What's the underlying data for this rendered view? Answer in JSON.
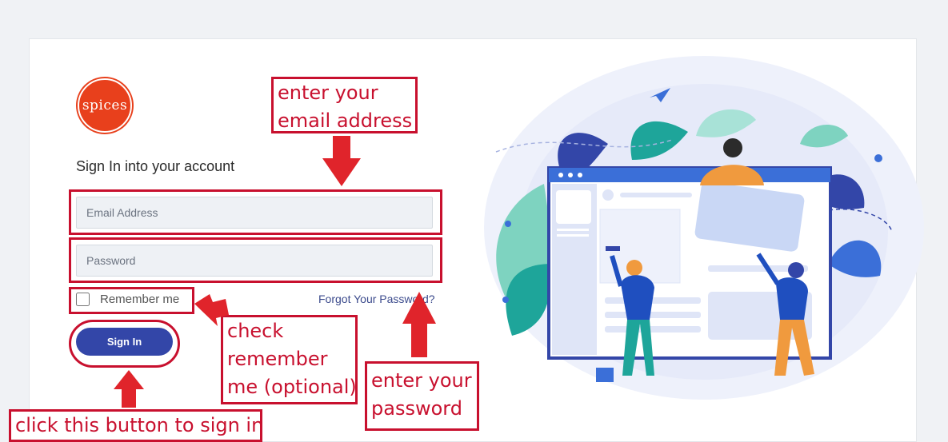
{
  "logo": {
    "text": "spices"
  },
  "form": {
    "heading": "Sign In into your account",
    "email_placeholder": "Email Address",
    "password_placeholder": "Password",
    "remember_label": "Remember me",
    "forgot_link": "Forgot Your Password?",
    "signin_label": "Sign In"
  },
  "annotations": {
    "email": [
      "enter your",
      "email address"
    ],
    "remember": [
      "check",
      "remember",
      "me (optional)"
    ],
    "password": [
      "enter your",
      "password"
    ],
    "signin": [
      "click this button to sign in"
    ]
  },
  "colors": {
    "accent": "#3346a8",
    "annotation": "#c8102e",
    "logo": "#e8401c"
  },
  "icons": [
    "arrow-down-icon",
    "arrow-left-icon",
    "arrow-up-icon",
    "paper-plane-icon"
  ]
}
